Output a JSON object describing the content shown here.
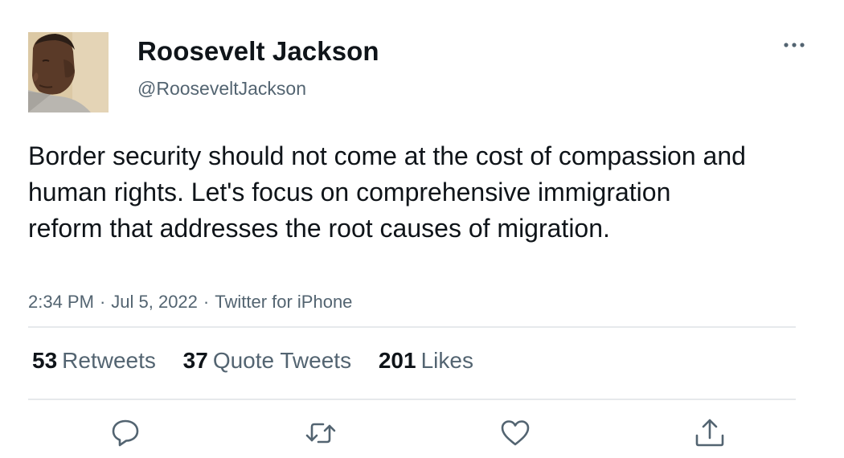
{
  "tweet": {
    "author": {
      "display_name": "Roosevelt Jackson",
      "handle": "@RooseveltJackson"
    },
    "text": "Border security should not come at the cost of compassion and human rights. Let's focus on comprehensive immigration reform that addresses the root causes of migration.",
    "meta": {
      "time": "2:34 PM",
      "separator": "·",
      "date": "Jul 5, 2022",
      "source": "Twitter for iPhone"
    },
    "stats": {
      "retweets": {
        "count": "53",
        "label": "Retweets"
      },
      "quote_tweets": {
        "count": "37",
        "label": "Quote Tweets"
      },
      "likes": {
        "count": "201",
        "label": "Likes"
      }
    },
    "actions": [
      "reply-icon",
      "retweet-icon",
      "like-icon",
      "share-icon"
    ],
    "colors": {
      "text": "#0f1419",
      "secondary": "#536471",
      "divider": "#e6e9ec",
      "icon": "#536471"
    }
  }
}
